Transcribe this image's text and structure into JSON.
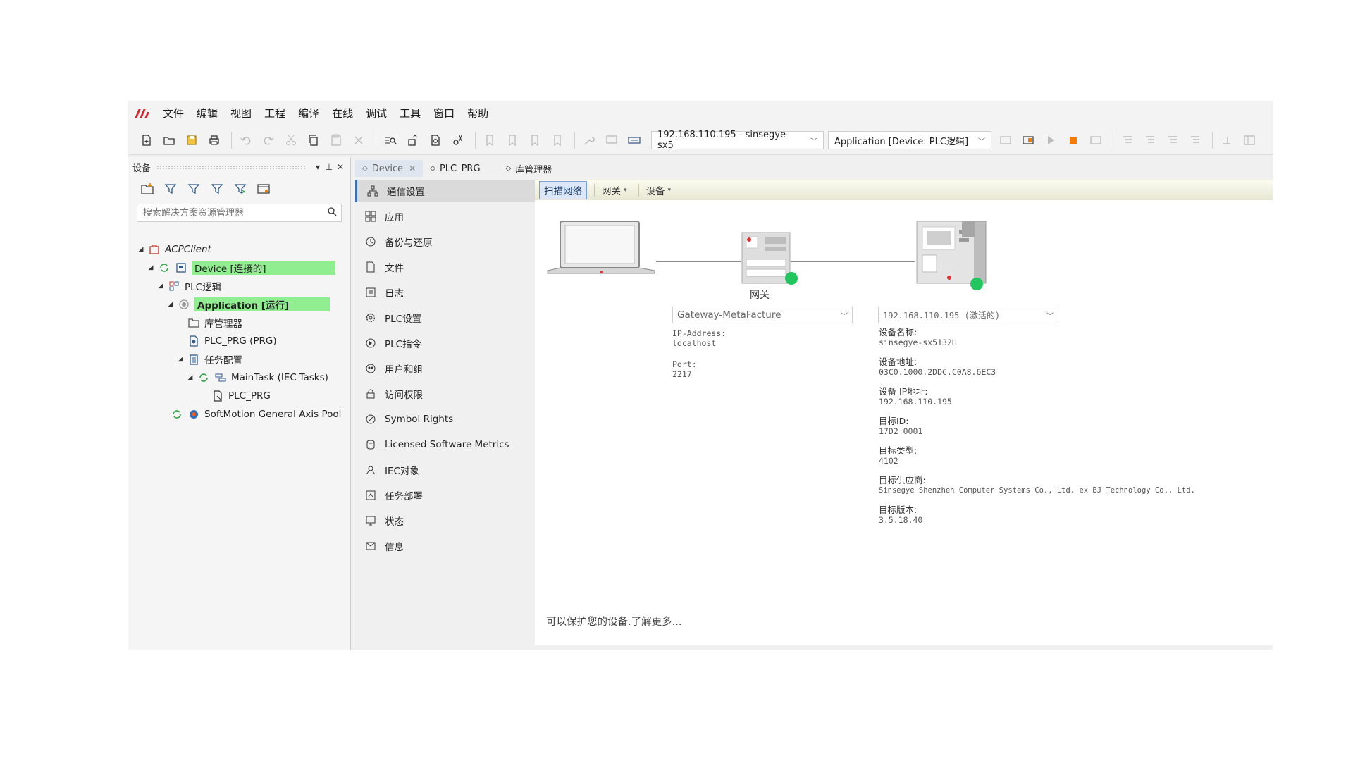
{
  "app": {
    "menu": [
      "文件",
      "编辑",
      "视图",
      "工程",
      "编译",
      "在线",
      "调试",
      "工具",
      "窗口",
      "帮助"
    ]
  },
  "toolbar": {
    "device_combo": "192.168.110.195 - sinsegye-sx5",
    "application_combo": "Application [Device: PLC逻辑]",
    "accent_stop_color": "#f57c00"
  },
  "left_panel": {
    "title": "设备",
    "search_placeholder": "搜索解决方案资源管理器",
    "tree": [
      {
        "label": "ACPClient",
        "icon": "project-icon"
      },
      {
        "label": "Device [连接的]",
        "icon": "device-icon",
        "highlight": true
      },
      {
        "label": "PLC逻辑",
        "icon": "plc-logic-icon"
      },
      {
        "label": "Application [运行]",
        "icon": "application-icon",
        "highlight": true
      },
      {
        "label": "库管理器",
        "icon": "folder-icon"
      },
      {
        "label": "PLC_PRG (PRG)",
        "icon": "program-icon"
      },
      {
        "label": "任务配置",
        "icon": "task-config-icon"
      },
      {
        "label": "MainTask (IEC-Tasks)",
        "icon": "task-icon"
      },
      {
        "label": "PLC_PRG",
        "icon": "program-call-icon"
      },
      {
        "label": "SoftMotion General Axis Pool",
        "icon": "axis-pool-icon"
      }
    ]
  },
  "tabs": [
    {
      "label": "Device",
      "active": true
    },
    {
      "label": "PLC_PRG",
      "active": false
    },
    {
      "label": "库管理器",
      "active": false
    }
  ],
  "nav": [
    "通信设置",
    "应用",
    "备份与还原",
    "文件",
    "日志",
    "PLC设置",
    "PLC指令",
    "用户和组",
    "访问权限",
    "Symbol Rights",
    "Licensed Software Metrics",
    "IEC对象",
    "任务部署",
    "状态",
    "信息"
  ],
  "comm": {
    "toolbar": {
      "scan": "扫描网络",
      "gateway": "网关",
      "device": "设备"
    },
    "gateway_label": "网关",
    "gateway_combo": "Gateway-MetaFacture",
    "gateway_info": {
      "ip_label": "IP-Address:",
      "ip_value": "localhost",
      "port_label": "Port:",
      "port_value": "2217"
    },
    "device_combo": "192.168.110.195 (激活的)",
    "device_info": {
      "name_label": "设备名称:",
      "name_value": "sinsegye-sx5132H",
      "addr_label": "设备地址:",
      "addr_value": "03C0.1000.2DDC.C0A8.6EC3",
      "ip_label": "设备 IP地址:",
      "ip_value": "192.168.110.195",
      "target_id_label": "目标ID:",
      "target_id_value": "17D2 0001",
      "target_type_label": "目标类型:",
      "target_type_value": "4102",
      "vendor_label": "目标供应商:",
      "vendor_value": "Sinsegye Shenzhen Computer Systems Co., Ltd. ex BJ Technology Co., Ltd.",
      "version_label": "目标版本:",
      "version_value": "3.5.18.40"
    },
    "footer": "可以保护您的设备.了解更多..."
  }
}
